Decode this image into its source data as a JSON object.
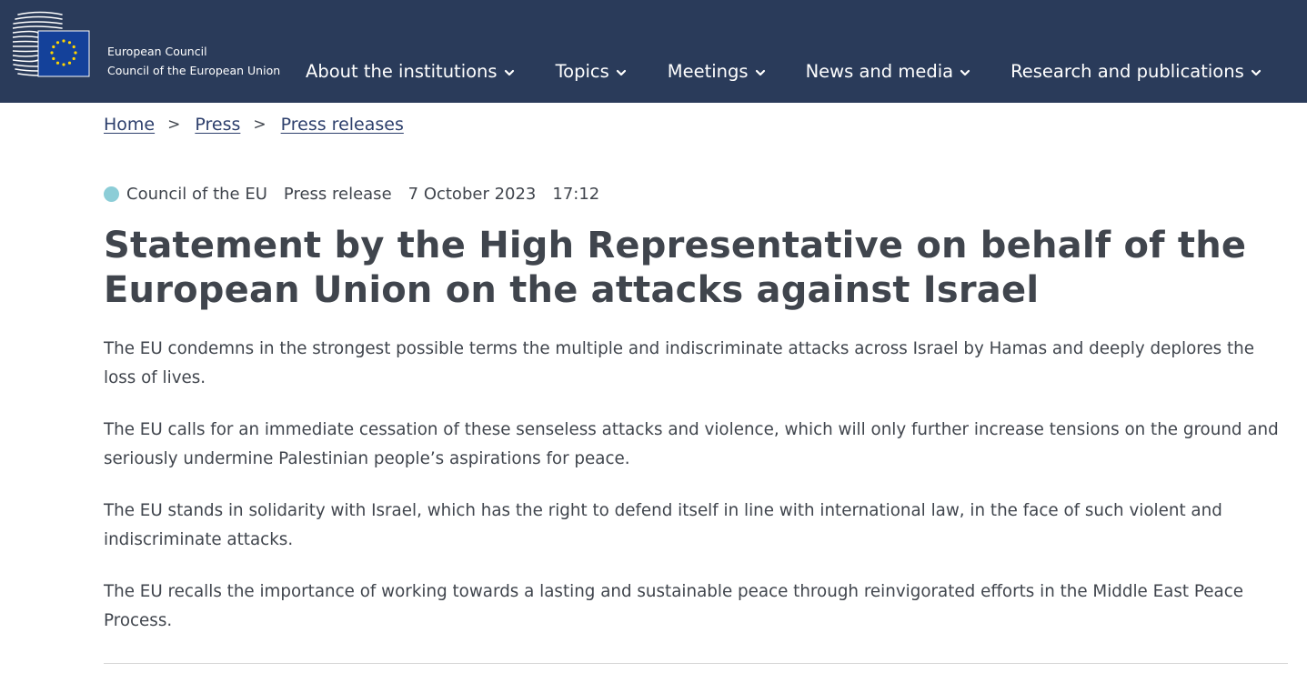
{
  "header": {
    "brand_line1": "European Council",
    "brand_line2": "Council of the European Union",
    "bg_color": "#2a3b5a",
    "nav": [
      {
        "label": "About the institutions",
        "icon": "chevron-down-icon"
      },
      {
        "label": "Topics",
        "icon": "chevron-down-icon"
      },
      {
        "label": "Meetings",
        "icon": "chevron-down-icon"
      },
      {
        "label": "News and media",
        "icon": "chevron-down-icon"
      },
      {
        "label": "Research and publications",
        "icon": "chevron-down-icon"
      }
    ]
  },
  "breadcrumb": {
    "items": [
      "Home",
      "Press",
      "Press releases"
    ],
    "separator": ">"
  },
  "meta": {
    "institution": "Council of the EU",
    "type": "Press release",
    "date": "7 October 2023",
    "time": "17:12",
    "dot_color": "#8ccdd7"
  },
  "article": {
    "title": "Statement by the High Representative on behalf of the European Union on the attacks against Israel",
    "paragraphs": [
      "The EU condemns in the strongest possible terms the multiple and indiscriminate attacks across Israel by Hamas and deeply deplores the loss of lives.",
      "The EU calls for an immediate cessation of these senseless attacks and violence, which will only further increase tensions on the ground and seriously undermine Palestinian people’s aspirations for peace.",
      "The EU stands in solidarity with Israel, which has the right to defend itself in line with international law, in the face of such violent and indiscriminate attacks.",
      "The EU recalls the importance of working towards a lasting and sustainable peace through reinvigorated efforts in the Middle East Peace Process."
    ]
  }
}
